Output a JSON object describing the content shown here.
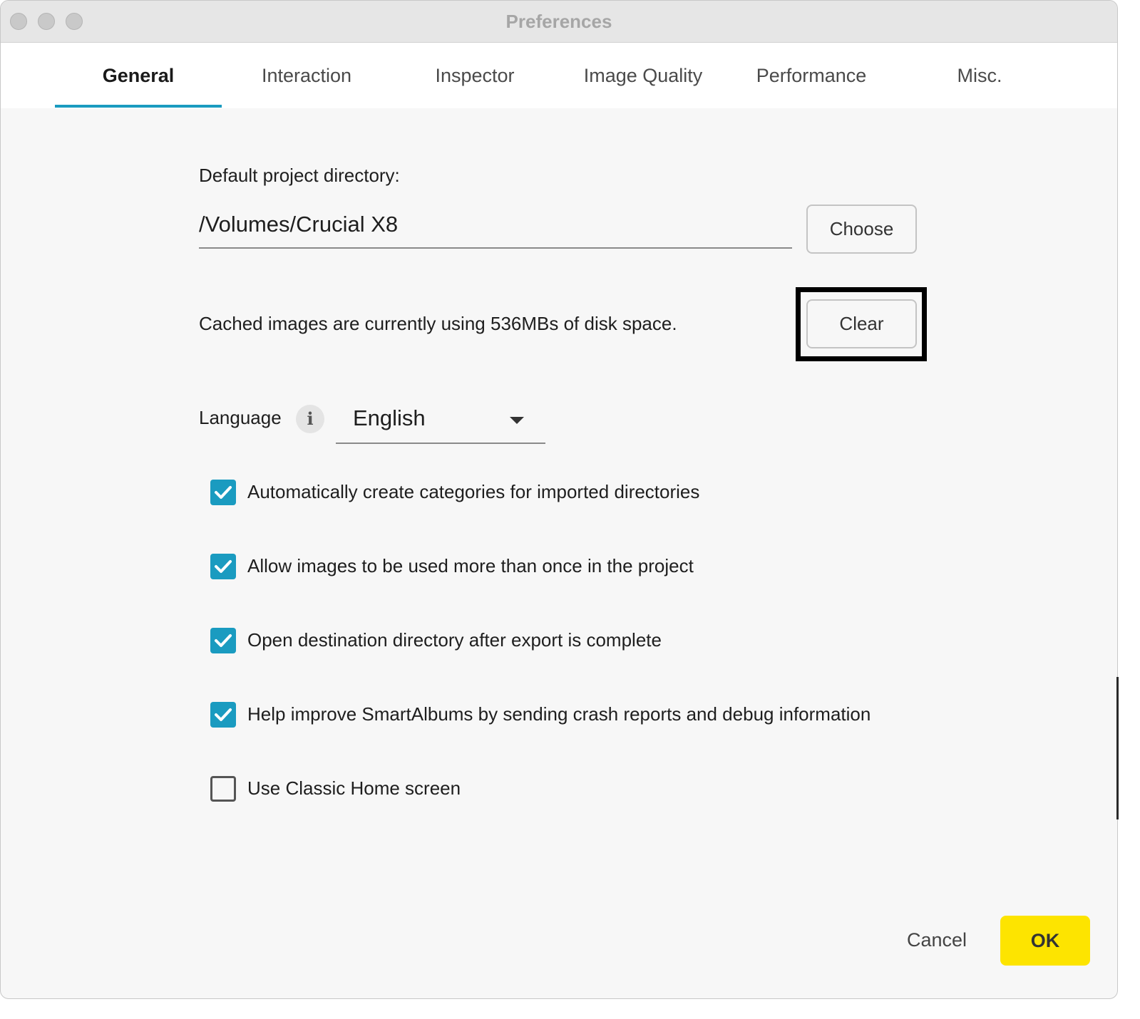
{
  "window": {
    "title": "Preferences"
  },
  "tabs": [
    {
      "label": "General",
      "active": true
    },
    {
      "label": "Interaction",
      "active": false
    },
    {
      "label": "Inspector",
      "active": false
    },
    {
      "label": "Image Quality",
      "active": false
    },
    {
      "label": "Performance",
      "active": false
    },
    {
      "label": "Misc.",
      "active": false
    }
  ],
  "general": {
    "project_dir_label": "Default project directory:",
    "project_dir_value": "/Volumes/Crucial X8",
    "choose_label": "Choose",
    "cache_text": "Cached images are currently using 536MBs of disk space.",
    "clear_label": "Clear",
    "language_label": "Language",
    "info_glyph": "i",
    "language_value": "English",
    "options": [
      {
        "label": "Automatically create categories for imported directories",
        "checked": true
      },
      {
        "label": "Allow images to be used more than once in the project",
        "checked": true
      },
      {
        "label": "Open destination directory after export is complete",
        "checked": true
      },
      {
        "label": "Help improve SmartAlbums by sending crash reports and debug information",
        "checked": true
      },
      {
        "label": "Use Classic Home screen",
        "checked": false
      }
    ]
  },
  "footer": {
    "cancel_label": "Cancel",
    "ok_label": "OK"
  },
  "colors": {
    "accent": "#1a9bc0",
    "ok_button": "#fde400",
    "window_bg": "#f7f7f7"
  }
}
